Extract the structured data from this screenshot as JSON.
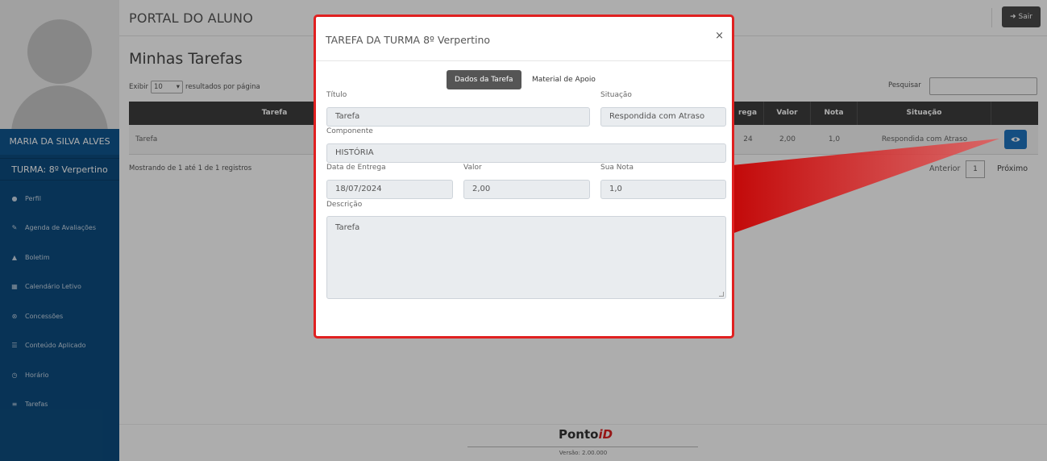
{
  "sidebar": {
    "student_name": "MARIA DA SILVA ALVES",
    "student_class": "TURMA: 8º Verpertino",
    "items": [
      {
        "label": "Perfil",
        "icon": "user-icon"
      },
      {
        "label": "Agenda de Avaliações",
        "icon": "edit-icon"
      },
      {
        "label": "Boletim",
        "icon": "graduation-cap-icon"
      },
      {
        "label": "Calendário Letivo",
        "icon": "calendar-icon"
      },
      {
        "label": "Concessões",
        "icon": "handshake-icon"
      },
      {
        "label": "Conteúdo Aplicado",
        "icon": "list-icon"
      },
      {
        "label": "Horário",
        "icon": "clock-icon"
      },
      {
        "label": "Tarefas",
        "icon": "tasks-icon"
      }
    ]
  },
  "topbar": {
    "title": "PORTAL DO ALUNO",
    "logout_label": "Sair"
  },
  "main": {
    "heading": "Minhas Tarefas",
    "show_prefix": "Exibir",
    "page_length": "10",
    "show_suffix": "resultados por página",
    "search_label": "Pesquisar",
    "table": {
      "columns": [
        "Tarefa",
        "rega",
        "Valor",
        "Nota",
        "Situação"
      ],
      "rows": [
        {
          "tarefa": "Tarefa",
          "entrega": "24",
          "valor": "2,00",
          "nota": "1,0",
          "situacao": "Respondida com Atraso"
        }
      ]
    },
    "records_info": "Mostrando de 1 até 1 de 1 registros",
    "pagination": {
      "prev": "Anterior",
      "page": "1",
      "next": "Próximo"
    }
  },
  "modal": {
    "title": "TAREFA DA TURMA 8º Verpertino",
    "close_symbol": "×",
    "tabs": [
      "Dados da Tarefa",
      "Material de Apoio"
    ],
    "fields": {
      "titulo_label": "Título",
      "titulo_value": "Tarefa",
      "situacao_label": "Situação",
      "situacao_value": "Respondida com Atraso",
      "componente_label": "Componente",
      "componente_value": "HISTÓRIA",
      "data_label": "Data de Entrega",
      "data_value": "18/07/2024",
      "valor_label": "Valor",
      "valor_value": "2,00",
      "nota_label": "Sua Nota",
      "nota_value": "1,0",
      "descricao_label": "Descrição",
      "descricao_value": "Tarefa"
    }
  },
  "footer": {
    "logo_text": "Ponto",
    "logo_id": "iD",
    "version": "Versão: 2.00.000"
  },
  "colors": {
    "sidebar": "#0d4c7f",
    "accent_button": "#1e73be",
    "highlight": "#e02020",
    "table_header": "#3d3d3d"
  }
}
